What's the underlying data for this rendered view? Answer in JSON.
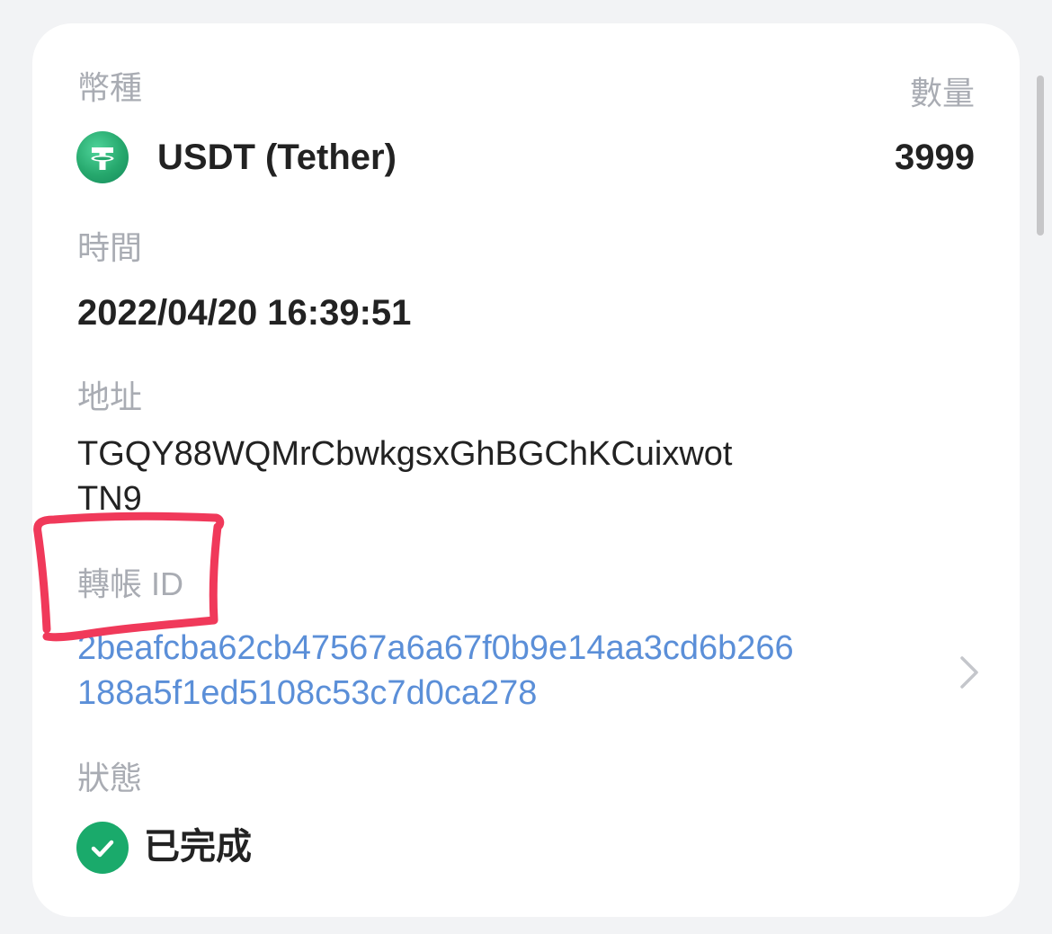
{
  "currency": {
    "label": "幣種",
    "name": "USDT (Tether)",
    "icon": "tether-icon",
    "icon_color": "#26a86d"
  },
  "amount": {
    "label": "數量",
    "value": "3999"
  },
  "time": {
    "label": "時間",
    "value": "2022/04/20 16:39:51"
  },
  "address": {
    "label": "地址",
    "value": "TGQY88WQMrCbwkgsxGhBGChKCuixwotTN9"
  },
  "transfer_id": {
    "label": "轉帳 ID",
    "value": "2beafcba62cb47567a6a67f0b9e14aa3cd6b266188a5f1ed5108c53c7d0ca278",
    "link_color": "#5b8fd8",
    "icon": "chevron-right-icon"
  },
  "status": {
    "label": "狀態",
    "value": "已完成",
    "icon": "check-circle-icon",
    "color": "#1aaa6b"
  },
  "annotation": {
    "color": "#f0395a",
    "target": "轉帳 ID"
  }
}
